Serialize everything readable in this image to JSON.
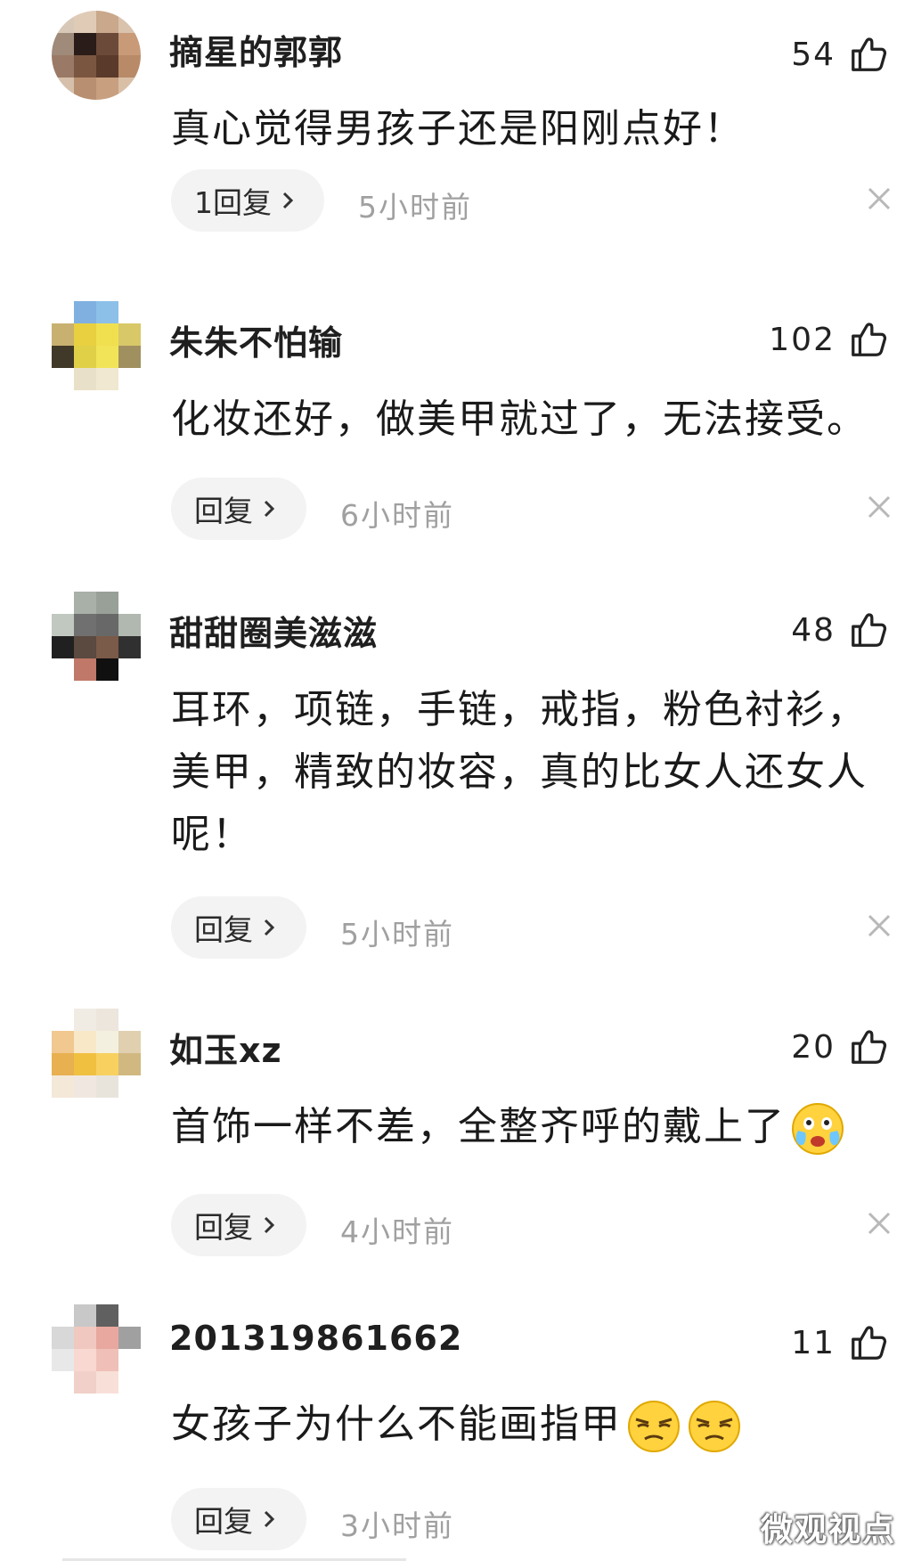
{
  "comments": [
    {
      "username": "摘星的郭郭",
      "likes": "54",
      "text": "真心觉得男孩子还是阳刚点好！",
      "reply_label": "1回复",
      "time": "5小时前",
      "avatar_colors": [
        "#d8c8b8",
        "#e0cbb6",
        "#c9a88c",
        "#d9c3ac",
        "#a08a7a",
        "#2a1c18",
        "#6b4a3a",
        "#c89a78",
        "#9a7a66",
        "#7a5640",
        "#5a3a2a",
        "#b88a68",
        "#d6c0ac",
        "#b88f70",
        "#c8a080",
        "#d9bfa6"
      ]
    },
    {
      "username": "朱朱不怕输",
      "likes": "102",
      "text": "化妆还好，做美甲就过了，无法接受。",
      "reply_label": "回复",
      "time": "6小时前",
      "avatar_colors": [
        "#ffffff",
        "#7fb0e0",
        "#8cc0e8",
        "#ffffff",
        "#c8b070",
        "#e8d040",
        "#f0e050",
        "#d8c868",
        "#403828",
        "#e0d048",
        "#f2e458",
        "#a09060",
        "#ffffff",
        "#e8e0c8",
        "#f0e8d0",
        "#ffffff"
      ]
    },
    {
      "username": "甜甜圈美滋滋",
      "likes": "48",
      "text": "耳环，项链，手链，戒指，粉色衬衫，美甲，精致的妆容，真的比女人还女人呢！",
      "reply_label": "回复",
      "time": "5小时前",
      "avatar_colors": [
        "#ffffff",
        "#a8b0a8",
        "#98a098",
        "#ffffff",
        "#c0c8c0",
        "#707070",
        "#686868",
        "#b0b8b0",
        "#202020",
        "#5a4a40",
        "#7a5a48",
        "#303030",
        "#ffffff",
        "#c07868",
        "#101010",
        "#ffffff"
      ]
    },
    {
      "username": "如玉xz",
      "likes": "20",
      "text": "首饰一样不差，全整齐呼的戴上了",
      "reply_label": "回复",
      "time": "4小时前",
      "avatar_colors": [
        "#ffffff",
        "#f0ece4",
        "#ece6dc",
        "#ffffff",
        "#f0c890",
        "#f8e8c8",
        "#f4f0e0",
        "#e0d0b0",
        "#e8b050",
        "#f0c040",
        "#f8d060",
        "#d0b880",
        "#f4e8d8",
        "#f0e8e0",
        "#e8e4dc",
        "#ffffff"
      ]
    },
    {
      "username": "201319861662",
      "likes": "11",
      "text": "女孩子为什么不能画指甲",
      "reply_label": "回复",
      "time": "3小时前",
      "avatar_colors": [
        "#ffffff",
        "#c8c8c8",
        "#606060",
        "#ffffff",
        "#d8d8d8",
        "#f0c8c0",
        "#e8a8a0",
        "#a0a0a0",
        "#e8e8e8",
        "#f8d8d0",
        "#f0c0b8",
        "#ffffff",
        "#ffffff",
        "#f0d0c8",
        "#f8e0d8",
        "#ffffff"
      ]
    }
  ],
  "watermark": "微观视点",
  "icons": {
    "like": "thumbs-up-icon",
    "close": "close-icon",
    "chevron": "chevron-right-icon",
    "emoji_cry": "crying-laughing-emoji",
    "emoji_smirk": "smirk-emoji"
  },
  "colors": {
    "time_text": "#a0a0a0",
    "reply_bg": "#f3f3f3"
  }
}
